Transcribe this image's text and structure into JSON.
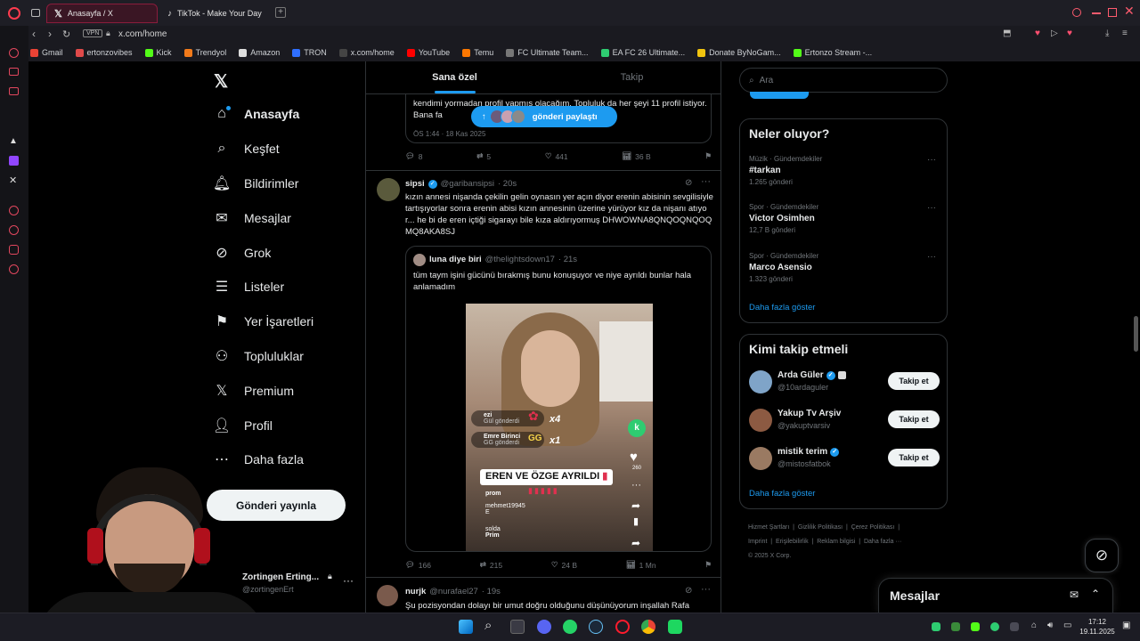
{
  "browser": {
    "tabs": [
      {
        "title": "Anasayfa / X",
        "active": true
      },
      {
        "title": "TikTok - Make Your Day",
        "active": false
      }
    ],
    "vpn_label": "VPN",
    "url": "x.com/home",
    "bookmarks": [
      "Gmail",
      "ertonzovibes",
      "Kick",
      "Trendyol",
      "Amazon",
      "TRON",
      "x.com/home",
      "YouTube",
      "Temu",
      "FC Ultimate Team...",
      "EA FC 26 Ultimate...",
      "Donate ByNoGam...",
      "Ertonzo Stream -..."
    ]
  },
  "nav": {
    "items": [
      "Anasayfa",
      "Keşfet",
      "Bildirimler",
      "Mesajlar",
      "Grok",
      "Listeler",
      "Yer İşaretleri",
      "Topluluklar",
      "Premium",
      "Profil",
      "Daha fazla"
    ],
    "post_button": "Gönderi yayınla",
    "account_name": "Zortingen Erting...",
    "account_handle": "@zortingenErt"
  },
  "feed": {
    "tabs": [
      "Sana özel",
      "Takip"
    ],
    "prev_tweet": {
      "text": "kendimi yormadan profil yapmış olacağım. Topluluk da her şeyi 11 profil istiyor. Bana fa",
      "time": "ÖS 1:44 · 18 Kas 2025",
      "replies": "8",
      "reposts": "5",
      "likes": "441",
      "views": "36 B"
    },
    "new_posts_pill": "gönderi paylaştı",
    "tweet": {
      "name": "sipsi",
      "handle": "@garibansipsi",
      "age": "· 20s",
      "text": "kızın annesi nişanda çekilin gelin oynasın yer açın diyor erenin abisinin sevgilisiyle tartışıyorlar sonra erenin abisi kızın annesinin üzerine yürüyor kız da nişanı atıyor... he bi de eren içtiği sigarayı bile kıza aldırıyormuş DHWOWNA8QNQOQNQOQMQ8AKA8SJ",
      "quote": {
        "name": "luna diye biri",
        "handle": "@thelightsdown17",
        "age": "· 21s",
        "text": "tüm taym işini gücünü bırakmış bunu konuşuyor ve niye ayrıldı bunlar hala anlamadım",
        "video": {
          "banner": "EREN VE ÖZGE AYRILDI",
          "comments": [
            {
              "user": "ezi",
              "sub": "Gül gönderdi",
              "count": "x4"
            },
            {
              "user": "Emre Birinci",
              "sub": "GG gönderdi",
              "count": "x1"
            },
            {
              "user": "prom",
              "sub": ""
            },
            {
              "user": "mehmet19945",
              "sub": "E"
            },
            {
              "user": "solda",
              "sub": "Prim"
            }
          ],
          "side_count": "260"
        }
      },
      "replies": "166",
      "reposts": "215",
      "likes": "24 B",
      "views": "1 Mn"
    },
    "next_tweet": {
      "name": "nurjk",
      "handle": "@nurafael27",
      "age": "· 19s",
      "text": "Şu pozisyondan dolayı bir umut doğru olduğunu düşünüyorum inşallah Rafa"
    }
  },
  "right": {
    "search_placeholder": "Ara",
    "trends_title": "Neler oluyor?",
    "trends": [
      {
        "category": "Müzik · Gündemdekiler",
        "name": "#tarkan",
        "count": "1.265 gönderi"
      },
      {
        "category": "Spor · Gündemdekiler",
        "name": "Victor Osimhen",
        "count": "12,7 B gönderi"
      },
      {
        "category": "Spor · Gündemdekiler",
        "name": "Marco Asensio",
        "count": "1.323 gönderi"
      }
    ],
    "show_more": "Daha fazla göster",
    "who_title": "Kimi takip etmeli",
    "who": [
      {
        "name": "Arda Güler",
        "handle": "@10ardaguler"
      },
      {
        "name": "Yakup Tv Arşiv",
        "handle": "@yakuptvarsiv"
      },
      {
        "name": "mistik terim",
        "handle": "@mistosfatbok"
      }
    ],
    "follow_label": "Takip et",
    "footer": [
      "Hizmet Şartları",
      "Gizlilik Politikası",
      "Çerez Politikası",
      "Imprint",
      "Erişilebilirlik",
      "Reklam bilgisi",
      "Daha fazla ···"
    ],
    "copyright": "© 2025 X Corp.",
    "messages_label": "Mesajlar"
  },
  "taskbar": {
    "time": "17:12",
    "date": "19.11.2025"
  },
  "colors": {
    "accent": "#1d9bf0",
    "bg": "#000000",
    "border": "#2f3336",
    "muted": "#71767b"
  }
}
